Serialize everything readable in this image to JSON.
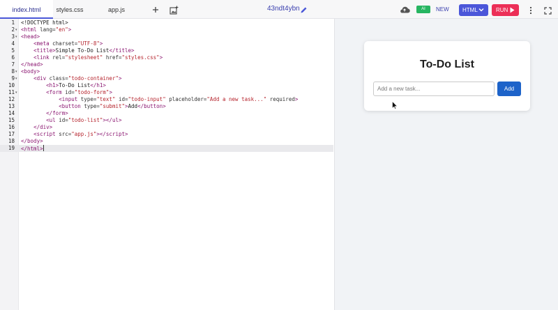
{
  "tabs": [
    {
      "label": "index.html",
      "active": true
    },
    {
      "label": "styles.css",
      "active": false
    },
    {
      "label": "app.js",
      "active": false
    }
  ],
  "toolbar": {
    "project_name": "43ndt4ybn",
    "ai_label": "AI",
    "new_label": "NEW",
    "language_label": "HTML",
    "run_label": "RUN"
  },
  "editor": {
    "current_line": 19,
    "lines": [
      {
        "n": "1",
        "html": "&lt;!DOCTYPE html&gt;",
        "fold": false
      },
      {
        "n": "2",
        "html": "<span class='t'>&lt;html</span> <span class='a'>lang=</span><span class='s'>\"en\"</span><span class='t'>&gt;</span>",
        "fold": true
      },
      {
        "n": "3",
        "html": "<span class='t'>&lt;head&gt;</span>",
        "fold": true
      },
      {
        "n": "4",
        "html": "    <span class='t'>&lt;meta</span> <span class='a'>charset=</span><span class='s'>\"UTF-8\"</span><span class='t'>&gt;</span>",
        "fold": false
      },
      {
        "n": "5",
        "html": "    <span class='t'>&lt;title&gt;</span>Simple To-Do List<span class='t'>&lt;/title&gt;</span>",
        "fold": false
      },
      {
        "n": "6",
        "html": "    <span class='t'>&lt;link</span> <span class='a'>rel=</span><span class='s'>\"stylesheet\"</span> <span class='a'>href=</span><span class='s'>\"styles.css\"</span><span class='t'>&gt;</span>",
        "fold": false
      },
      {
        "n": "7",
        "html": "<span class='t'>&lt;/head&gt;</span>",
        "fold": false
      },
      {
        "n": "8",
        "html": "<span class='t'>&lt;body&gt;</span>",
        "fold": true
      },
      {
        "n": "9",
        "html": "    <span class='t'>&lt;div</span> <span class='a'>class=</span><span class='s'>\"todo-container\"</span><span class='t'>&gt;</span>",
        "fold": true
      },
      {
        "n": "10",
        "html": "        <span class='t'>&lt;h1&gt;</span>To-Do List<span class='t'>&lt;/h1&gt;</span>",
        "fold": false
      },
      {
        "n": "11",
        "html": "        <span class='t'>&lt;form</span> <span class='a'>id=</span><span class='s'>\"todo-form\"</span><span class='t'>&gt;</span>",
        "fold": true
      },
      {
        "n": "12",
        "html": "            <span class='t'>&lt;input</span> <span class='a'>type=</span><span class='s'>\"text\"</span> <span class='a'>id=</span><span class='s'>\"todo-input\"</span> <span class='a'>placeholder=</span><span class='s'>\"Add a new task...\"</span> <span class='a'>required</span><span class='t'>&gt;</span>",
        "fold": false
      },
      {
        "n": "13",
        "html": "            <span class='t'>&lt;button</span> <span class='a'>type=</span><span class='s'>\"submit\"</span><span class='t'>&gt;</span>Add<span class='t'>&lt;/button&gt;</span>",
        "fold": false
      },
      {
        "n": "14",
        "html": "        <span class='t'>&lt;/form&gt;</span>",
        "fold": false
      },
      {
        "n": "15",
        "html": "        <span class='t'>&lt;ul</span> <span class='a'>id=</span><span class='s'>\"todo-list\"</span><span class='t'>&gt;&lt;/ul&gt;</span>",
        "fold": false
      },
      {
        "n": "16",
        "html": "    <span class='t'>&lt;/div&gt;</span>",
        "fold": false
      },
      {
        "n": "17",
        "html": "    <span class='t'>&lt;script</span> <span class='a'>src=</span><span class='s'>\"app.js\"</span><span class='t'>&gt;&lt;/script&gt;</span>",
        "fold": false
      },
      {
        "n": "18",
        "html": "<span class='t'>&lt;/body&gt;</span>",
        "fold": false
      },
      {
        "n": "19",
        "html": "<span class='t'>&lt;/html&gt;</span><span class='cursor'></span>",
        "fold": false
      }
    ]
  },
  "preview": {
    "title": "To-Do List",
    "input_placeholder": "Add a new task...",
    "add_label": "Add"
  },
  "colors": {
    "accent": "#4b56d9",
    "run": "#ec2f57",
    "ai": "#27b561",
    "add_button": "#1d63c9"
  },
  "icons": [
    "add-tab-icon",
    "add-image-icon",
    "edit-icon",
    "cloud-upload-icon",
    "chevron-down-icon",
    "play-icon",
    "more-vertical-icon",
    "expand-icon",
    "mouse-pointer-icon"
  ]
}
